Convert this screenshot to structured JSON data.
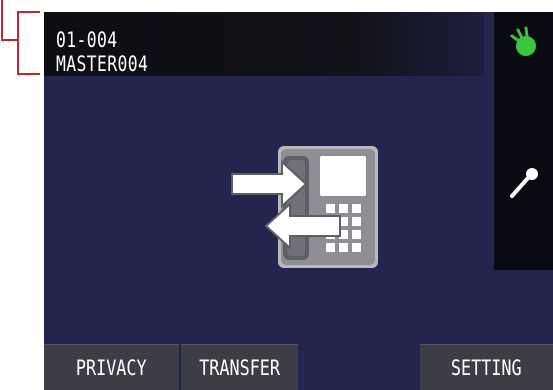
{
  "header": {
    "station_id": "01-004",
    "station_name": "MASTER004"
  },
  "side_panel": {
    "icons": [
      "status-led-icon",
      "microphone-icon"
    ]
  },
  "center": {
    "icon": "intercom-transfer-icon"
  },
  "footer": {
    "privacy_label": "PRIVACY",
    "transfer_label": "TRANSFER",
    "setting_label": "SETTING"
  },
  "colors": {
    "screen_bg": "#23254f",
    "header_bg": "#0d0d14",
    "button_bg": "#3d3d46",
    "status_green": "#3cc43c",
    "callout_red": "#c0262b"
  }
}
